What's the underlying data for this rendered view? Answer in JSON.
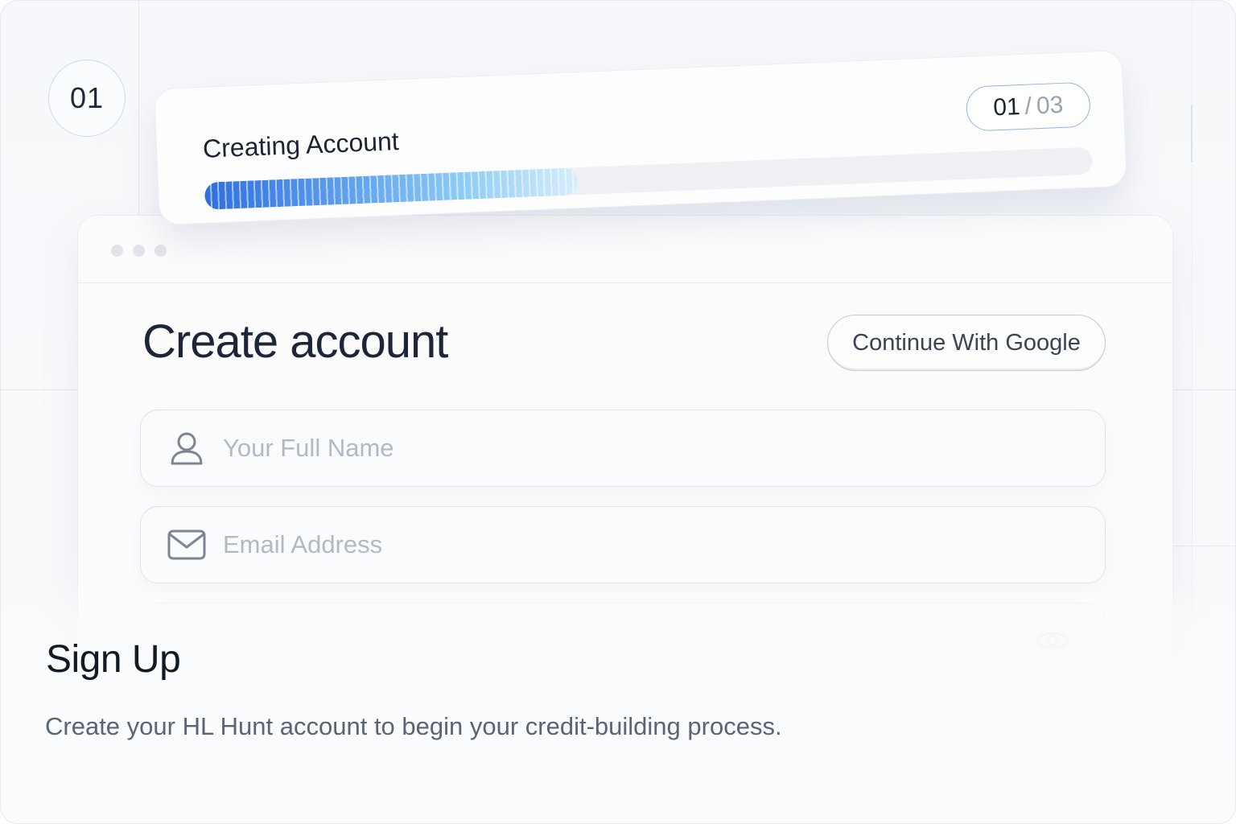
{
  "step": {
    "number": "01"
  },
  "progress": {
    "title": "Creating Account",
    "current": "01",
    "separator": "/",
    "total": "03",
    "fraction": 0.42
  },
  "form": {
    "title": "Create account",
    "google_button": "Continue With Google",
    "full_name": {
      "placeholder": "Your Full Name",
      "value": "",
      "icon": "user-icon"
    },
    "email": {
      "placeholder": "Email Address",
      "value": "",
      "icon": "mail-icon"
    },
    "password": {
      "icon": "eye-icon"
    }
  },
  "section": {
    "title": "Sign Up",
    "description": "Create your HL Hunt account to begin your credit-building process."
  },
  "colors": {
    "accent": "#2f6fe0",
    "progress_light": "#d6eefc",
    "title_text": "#1c2638",
    "border_accent": "#8fb7e2"
  }
}
